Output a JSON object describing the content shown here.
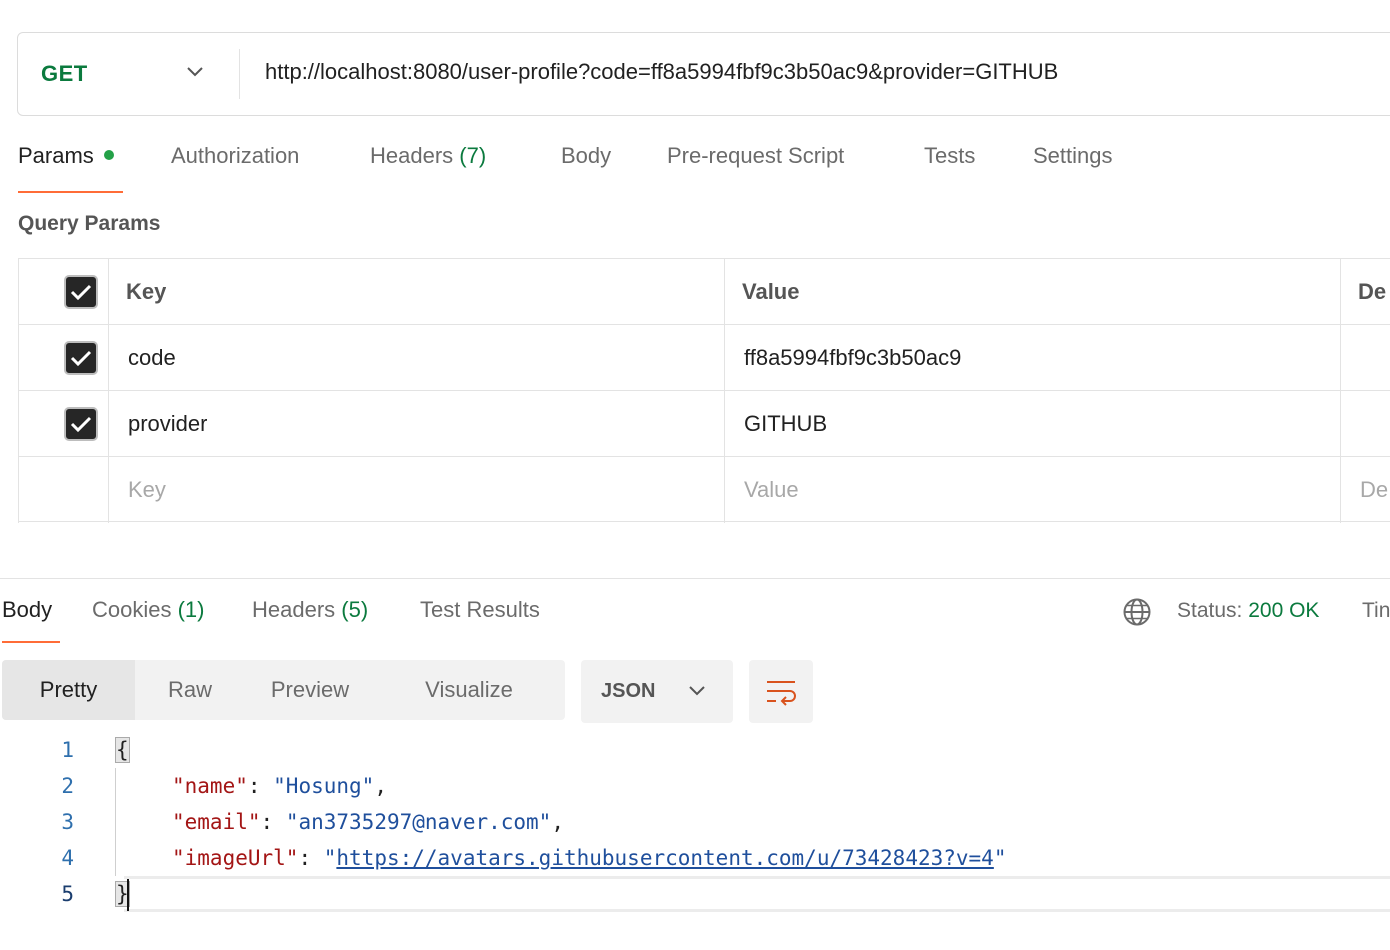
{
  "request": {
    "method": "GET",
    "url": "http://localhost:8080/user-profile?code=ff8a5994fbf9c3b50ac9&provider=GITHUB"
  },
  "request_tabs": [
    {
      "label": "Params",
      "count": ""
    },
    {
      "label": "Authorization",
      "count": ""
    },
    {
      "label": "Headers",
      "count": "(7)"
    },
    {
      "label": "Body",
      "count": ""
    },
    {
      "label": "Pre-request Script",
      "count": ""
    },
    {
      "label": "Tests",
      "count": ""
    },
    {
      "label": "Settings",
      "count": ""
    }
  ],
  "query_params": {
    "title": "Query Params",
    "headers": {
      "key": "Key",
      "value": "Value",
      "description": "De"
    },
    "rows": [
      {
        "key": "code",
        "value": "ff8a5994fbf9c3b50ac9"
      },
      {
        "key": "provider",
        "value": "GITHUB"
      }
    ],
    "placeholder": {
      "key": "Key",
      "value": "Value",
      "description": "De"
    }
  },
  "response_tabs": [
    {
      "label": "Body",
      "count": ""
    },
    {
      "label": "Cookies",
      "count": "(1)"
    },
    {
      "label": "Headers",
      "count": "(5)"
    },
    {
      "label": "Test Results",
      "count": ""
    }
  ],
  "status": {
    "label": "Status:",
    "value": "200 OK",
    "time_label": "Tin"
  },
  "view_modes": [
    "Pretty",
    "Raw",
    "Preview",
    "Visualize"
  ],
  "format": "JSON",
  "response_body": {
    "line_numbers": [
      "1",
      "2",
      "3",
      "4",
      "5"
    ],
    "open_brace": "{",
    "close_brace": "}",
    "fields": [
      {
        "key": "\"name\"",
        "value": "\"Hosung\"",
        "trail": ","
      },
      {
        "key": "\"email\"",
        "value": "\"an3735297@naver.com\"",
        "trail": ","
      },
      {
        "key": "\"imageUrl\"",
        "value_open": "\"",
        "link": "https://avatars.githubusercontent.com/u/73428423?v=4",
        "value_close": "\"",
        "trail": ""
      }
    ]
  },
  "colors": {
    "accent": "#ff6c37",
    "success": "#0b7a3e",
    "json_key": "#a31515",
    "json_string": "#1f4f9c"
  }
}
